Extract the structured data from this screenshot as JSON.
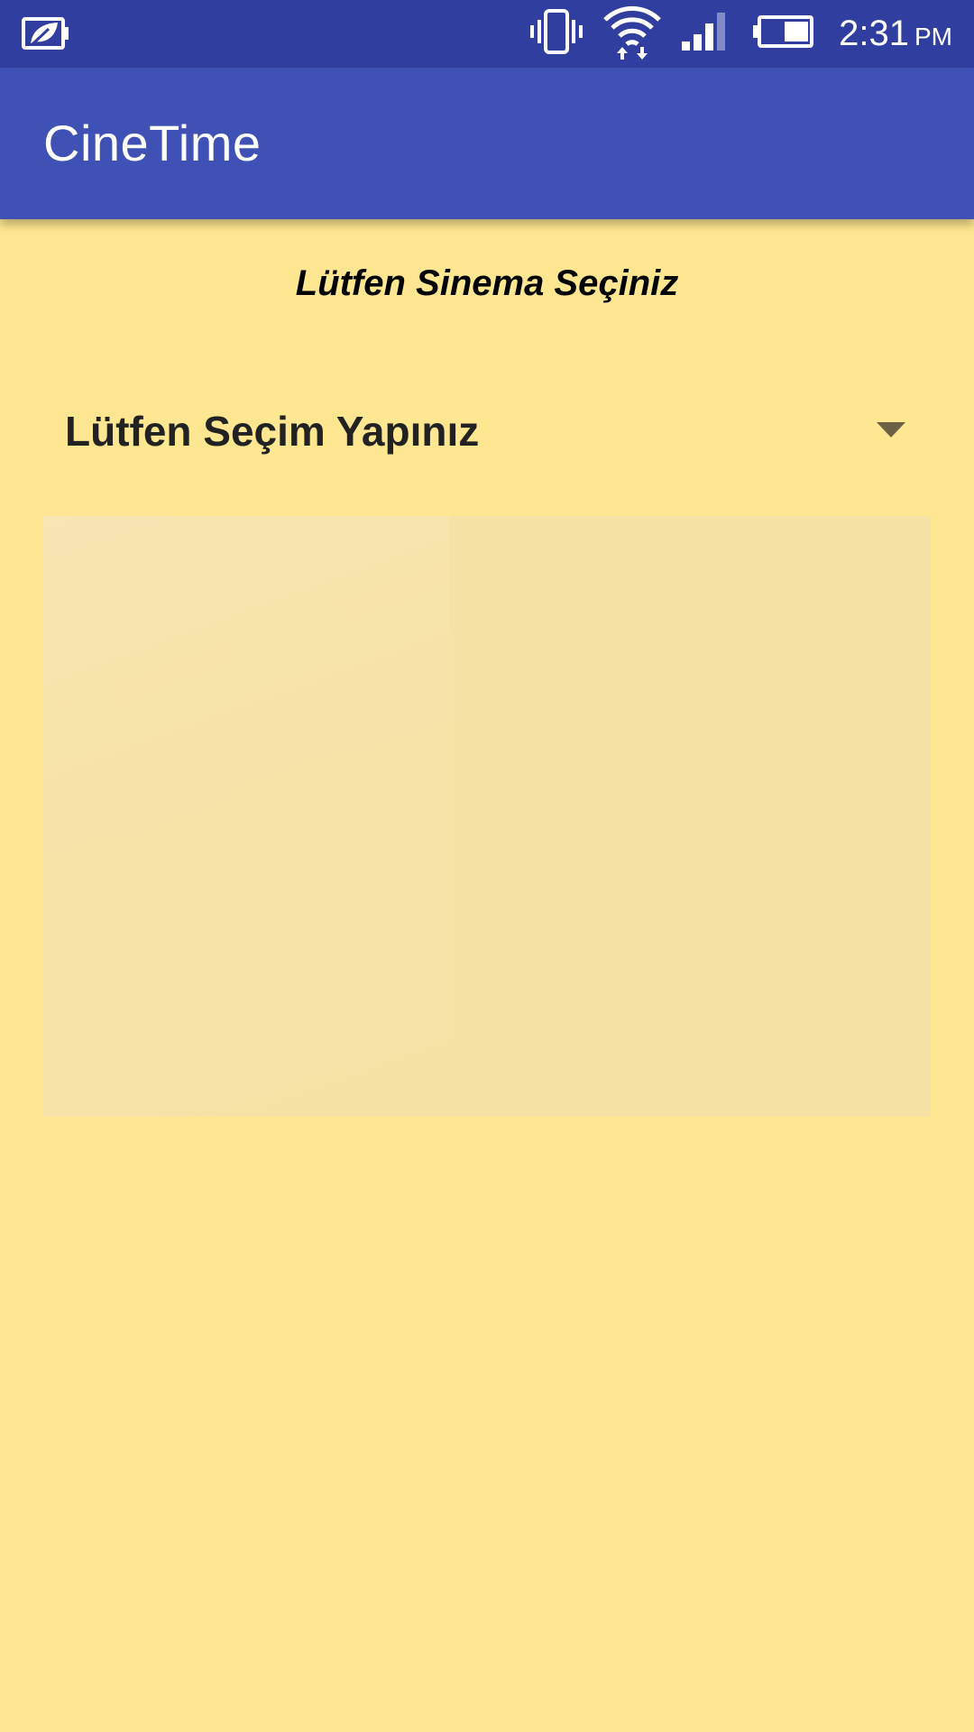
{
  "status_bar": {
    "left_icon": "battery-saver-leaf-icon",
    "icons": [
      "vibrate-icon",
      "wifi-icon",
      "signal-icon",
      "battery-icon"
    ],
    "time": "2:31",
    "ampm": "PM"
  },
  "app_bar": {
    "title": "CineTime"
  },
  "main": {
    "prompt": "Lütfen Sinema Seçiniz",
    "spinner_value": "Lütfen Seçim Yapınız"
  },
  "colors": {
    "status_bar": "#303F9F",
    "app_bar": "#3F51B5",
    "background": "#FFE791",
    "panel": "#F7E2A6"
  }
}
